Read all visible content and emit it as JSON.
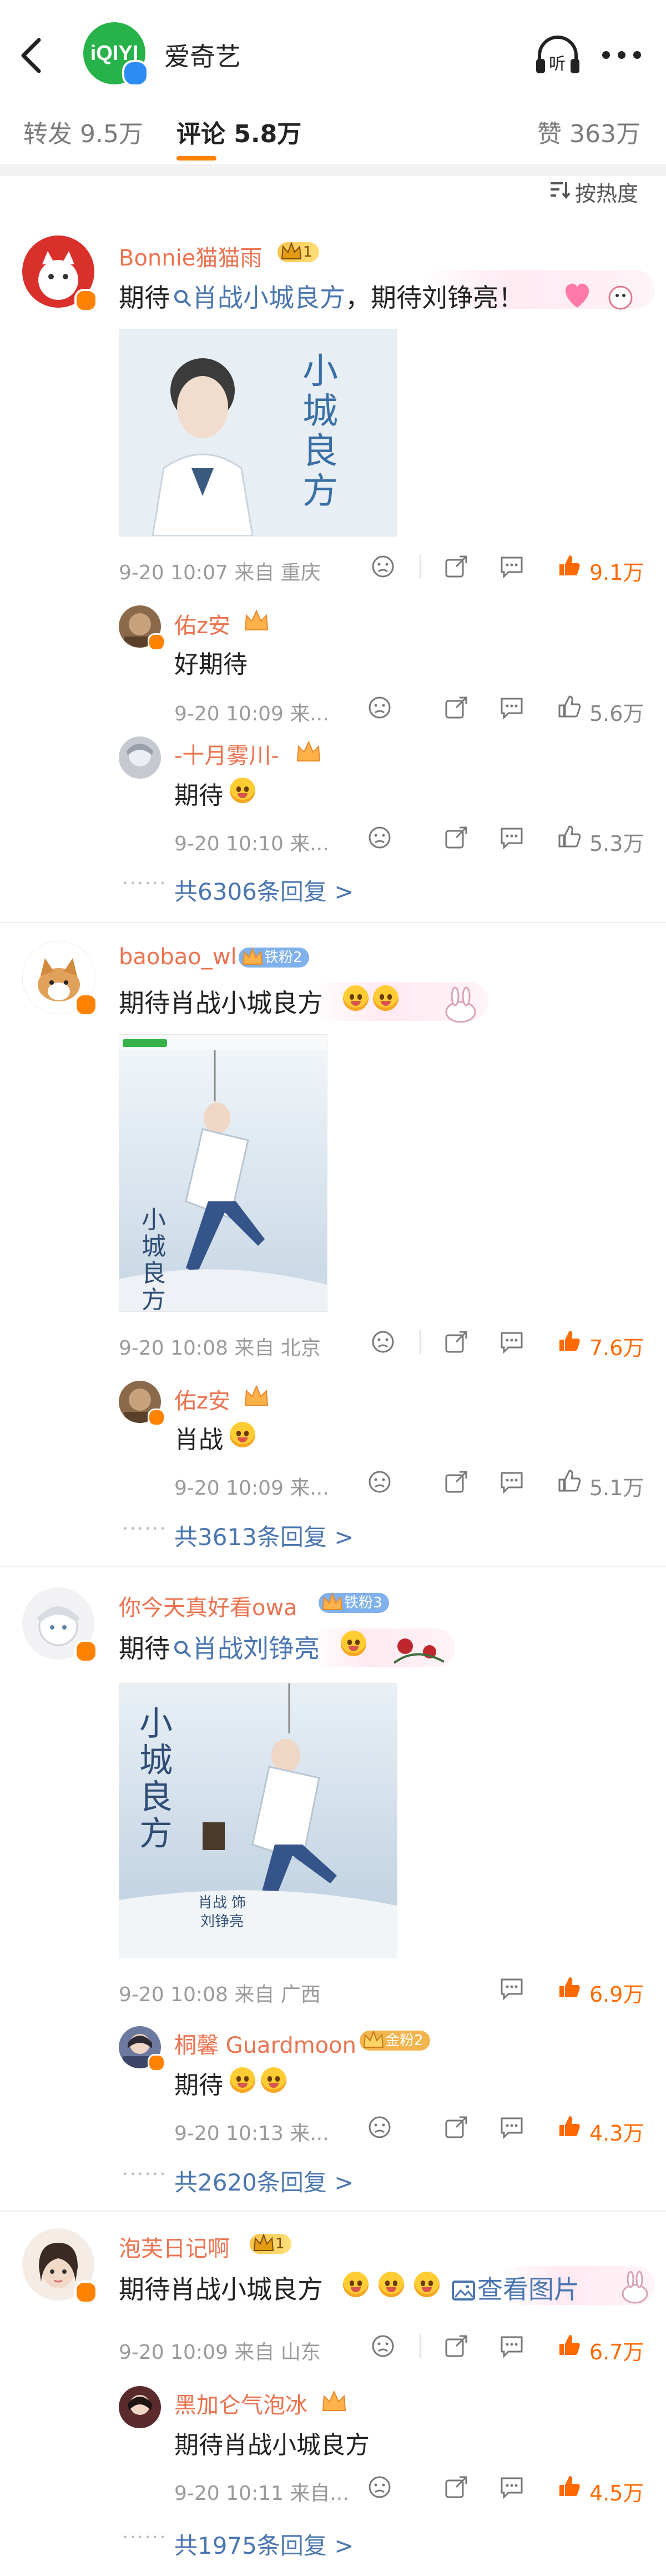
{
  "header": {
    "brand_logo_text": "iQIYI",
    "brand_name": "爱奇艺",
    "listen_label": "听"
  },
  "tabs": {
    "repost": "转发 9.5万",
    "comments": "评论 5.8万",
    "likes": "赞 363万"
  },
  "sort_label": "按热度",
  "comments": [
    {
      "user": "Bonnie猫猫雨",
      "badge": "1",
      "text_prefix": "期待",
      "link": "肖战小城良方",
      "text_suffix": "，期待刘铮亮！",
      "meta": "9-20 10:07  来自 重庆",
      "likes": "9.1万",
      "image_title": "小城良方",
      "replies": [
        {
          "user": "佑z安",
          "text": "好期待",
          "meta": "9-20 10:09  来...",
          "likes": "5.6万"
        },
        {
          "user": "-十月雾川-",
          "text": "期待",
          "meta": "9-20 10:10  来...",
          "likes": "5.3万"
        }
      ],
      "more_replies": "共6306条回复 >"
    },
    {
      "user": "baobao_wl",
      "badge": "铁粉2",
      "text": "期待肖战小城良方",
      "meta": "9-20 10:08  来自 北京",
      "likes": "7.6万",
      "image_title": "小城良方",
      "replies": [
        {
          "user": "佑z安",
          "text": "肖战",
          "meta": "9-20 10:09  来...",
          "likes": "5.1万"
        }
      ],
      "more_replies": "共3613条回复 >"
    },
    {
      "user": "你今天真好看owa",
      "badge": "铁粉3",
      "text_prefix": "期待",
      "link": "肖战刘铮亮",
      "meta": "9-20 10:08  来自 广西",
      "likes": "6.9万",
      "image_title": "小城良方",
      "image_caption": "肖战 饰 刘铮亮",
      "replies": [
        {
          "user": "桐馨 Guardmoon",
          "badge": "金粉2",
          "text": "期待",
          "meta": "9-20 10:13  来...",
          "likes": "4.3万"
        }
      ],
      "more_replies": "共2620条回复 >"
    },
    {
      "user": "泡芙日记啊",
      "badge": "1",
      "text": "期待肖战小城良方",
      "link": "查看图片",
      "meta": "9-20 10:09  来自 山东",
      "likes": "6.7万",
      "replies": [
        {
          "user": "黑加仑气泡冰",
          "text": "期待肖战小城良方",
          "meta": "9-20 10:11  来自...",
          "likes": "4.5万"
        }
      ],
      "more_replies": "共1975条回复 >"
    }
  ],
  "colors": {
    "accent": "#ff8200",
    "username": "#eb7350",
    "link": "#4a76b0",
    "like_hot": "#ff6a00"
  }
}
